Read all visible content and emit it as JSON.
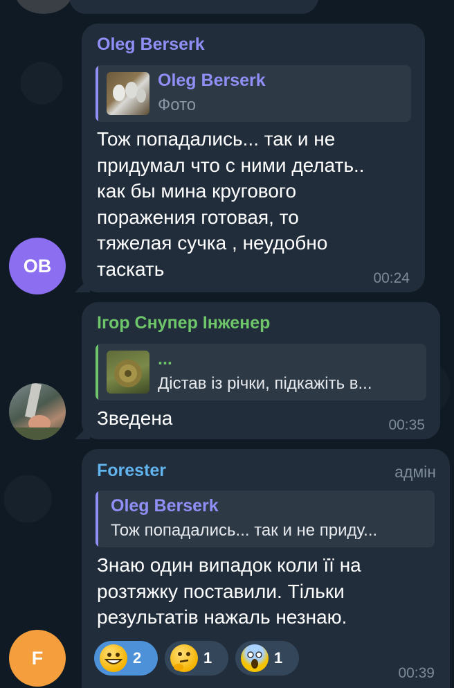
{
  "messages": [
    {
      "author": "Oleg Berserk",
      "author_color": "#8f8ff5",
      "reply": {
        "name": "Oleg Berserk",
        "text": "Фото",
        "bar_color": "#8f8ff5"
      },
      "text": "Тож попадались... так и не придумал что с ними делать.. как бы мина кругового поражения готовая, то тяжелая сучка , неудобно таскать",
      "time": "00:24",
      "avatar_initials": "OB",
      "avatar_color": "#8b6ff0"
    },
    {
      "author": "Ігор Снупер Інженер",
      "author_color": "#6ec56a",
      "reply": {
        "name": "...",
        "text": "Дістав із річки, підкажіть в...",
        "bar_color": "#6ec56a"
      },
      "text": "Зведена",
      "time": "00:35"
    },
    {
      "author": "Forester",
      "author_color": "#62b4ef",
      "badge": "адмін",
      "reply": {
        "name": "Oleg Berserk",
        "text": "Тож попадались... так и не приду...",
        "bar_color": "#8f8ff5"
      },
      "text": "Знаю один випадок коли її на розтяжку поставили. Тільки результатів нажаль незнаю.",
      "time": "00:39",
      "avatar_initials": "F",
      "avatar_color": "#f59e3d",
      "reactions": [
        {
          "emoji": "grinning-face-icon",
          "count": "2"
        },
        {
          "emoji": "thinking-face-icon",
          "count": "1"
        },
        {
          "emoji": "screaming-face-icon",
          "count": "1"
        }
      ]
    }
  ]
}
